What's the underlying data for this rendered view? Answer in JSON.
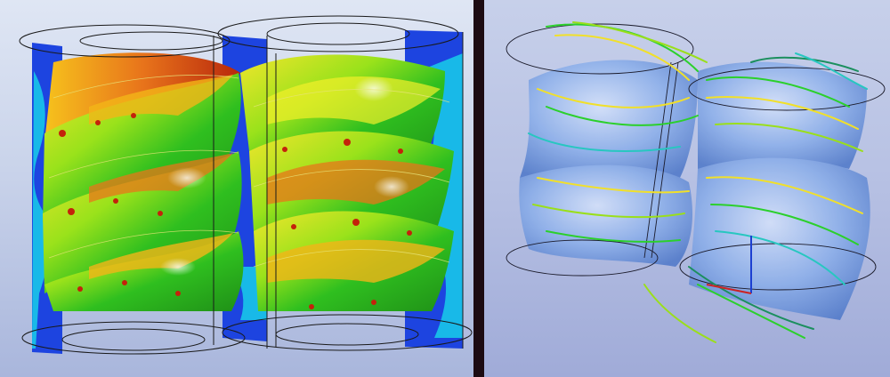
{
  "scene": {
    "left": {
      "view": "surface-contour",
      "colormap": [
        "#1b3fe0",
        "#18b4e6",
        "#36d39a",
        "#27c21f",
        "#8ae01b",
        "#f4ef2a",
        "#f3b316",
        "#e25b12",
        "#b81d0a"
      ],
      "cylinder_outline": "#1a1a1a"
    },
    "right": {
      "view": "streamlines",
      "surface_fill": "#7ea3e6",
      "streamline_colors": [
        "#2bd02b",
        "#9adf1a",
        "#f1e02a",
        "#27c7c0",
        "#1b8f5e"
      ],
      "axis_colors": {
        "x": "#cc2222",
        "y": "#1c3fd1"
      }
    }
  }
}
